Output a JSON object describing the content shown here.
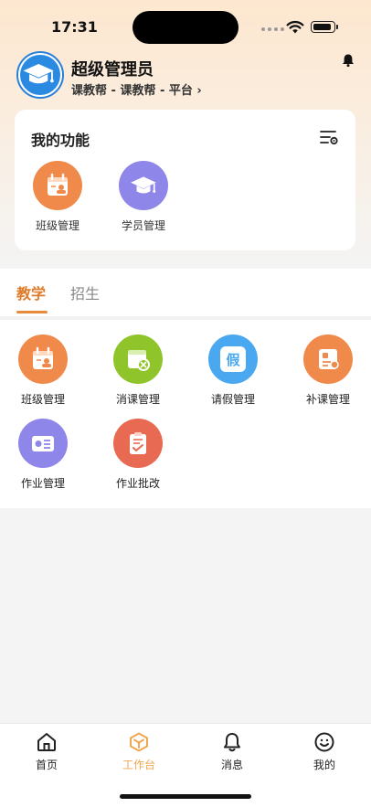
{
  "status_bar": {
    "time": "17:31"
  },
  "profile": {
    "name": "超级管理员",
    "org": "课教帮 - 课教帮 - 平台 ›"
  },
  "my_functions": {
    "title": "我的功能",
    "items": [
      {
        "label": "班级管理",
        "icon": "class-calendar-icon",
        "color": "#f08a4b"
      },
      {
        "label": "学员管理",
        "icon": "graduation-cap-icon",
        "color": "#8e86e8"
      }
    ]
  },
  "tabs": [
    {
      "label": "教学",
      "active": true
    },
    {
      "label": "招生",
      "active": false
    }
  ],
  "teaching_grid": [
    {
      "label": "班级管理",
      "icon": "class-calendar-icon",
      "color": "#f08a4b"
    },
    {
      "label": "消课管理",
      "icon": "cancel-class-icon",
      "color": "#8fc42a"
    },
    {
      "label": "请假管理",
      "icon": "leave-icon",
      "glyph": "假",
      "color": "#4aa8f0"
    },
    {
      "label": "补课管理",
      "icon": "makeup-class-icon",
      "color": "#f08a4b"
    },
    {
      "label": "作业管理",
      "icon": "homework-card-icon",
      "color": "#8e86e8"
    },
    {
      "label": "作业批改",
      "icon": "clipboard-check-icon",
      "color": "#e86a52"
    }
  ],
  "bottom_nav": [
    {
      "label": "首页",
      "icon": "home-icon",
      "active": false
    },
    {
      "label": "工作台",
      "icon": "workbench-cube-icon",
      "active": true
    },
    {
      "label": "消息",
      "icon": "bell-icon",
      "active": false
    },
    {
      "label": "我的",
      "icon": "smiley-icon",
      "active": false
    }
  ],
  "colors": {
    "accent": "#e07b2a",
    "nav_active": "#f0a850"
  }
}
